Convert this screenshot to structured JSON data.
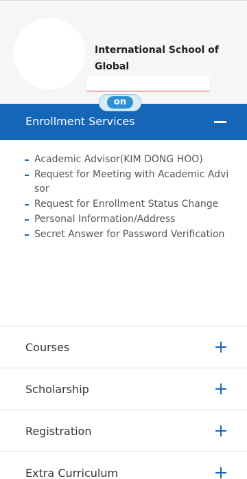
{
  "profile": {
    "school_name": "International School of Global",
    "name_value": ""
  },
  "badge": {
    "label": "on"
  },
  "menu": {
    "active_section": {
      "label": "Enrollment Services",
      "items": [
        {
          "label": "Academic Advisor(KIM DONG HOO)"
        },
        {
          "label": "Request for Meeting with Academic Advisor"
        },
        {
          "label": "Request for Enrollment Status Change"
        },
        {
          "label": "Personal Information/Address"
        },
        {
          "label": "Secret Answer for Password Verification"
        }
      ]
    },
    "sections": [
      {
        "label": "Courses"
      },
      {
        "label": "Scholarship"
      },
      {
        "label": "Registration"
      },
      {
        "label": "Extra Curriculum"
      }
    ]
  },
  "colors": {
    "accent": "#1566b6",
    "badge": "#2f8fd2"
  }
}
